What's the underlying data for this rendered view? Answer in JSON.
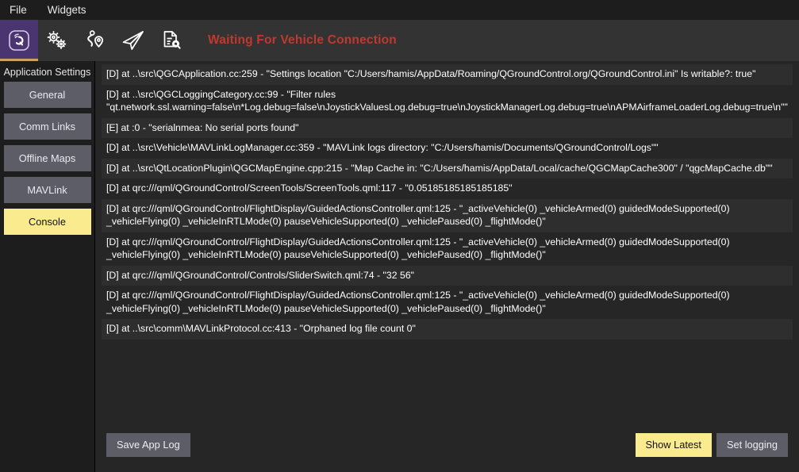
{
  "window": {
    "menu": [
      {
        "label": "File"
      },
      {
        "label": "Widgets"
      }
    ]
  },
  "toolbar": {
    "items": [
      {
        "icon": "qgc-logo-icon",
        "name": "toolbar-button-qgc-menu",
        "active": true
      },
      {
        "icon": "gears-icon",
        "name": "toolbar-button-settings",
        "active": false
      },
      {
        "icon": "waypoints-plan-icon",
        "name": "toolbar-button-plan",
        "active": false
      },
      {
        "icon": "paper-plane-icon",
        "name": "toolbar-button-fly",
        "active": false
      },
      {
        "icon": "document-search-icon",
        "name": "toolbar-button-analyze",
        "active": false
      }
    ],
    "status_text": "Waiting For Vehicle Connection",
    "status_color": "#c0392f",
    "active_highlight_color": "#4a3570",
    "active_underline_color": "#c8a35a"
  },
  "sidebar": {
    "title": "Application Settings",
    "items": [
      {
        "label": "General",
        "selected": false
      },
      {
        "label": "Comm Links",
        "selected": false
      },
      {
        "label": "Offline Maps",
        "selected": false
      },
      {
        "label": "MAVLink",
        "selected": false
      },
      {
        "label": "Console",
        "selected": true
      }
    ],
    "selected_color": "#faeb8e",
    "item_color": "#5d5d68"
  },
  "console": {
    "lines": [
      "[D] at ..\\src\\QGCApplication.cc:259 - \"Settings location \"C:/Users/hamis/AppData/Roaming/QGroundControl.org/QGroundControl.ini\" Is writable?: true\"",
      "[D] at ..\\src\\QGCLoggingCategory.cc:99 - \"Filter rules \"qt.network.ssl.warning=false\\n*Log.debug=false\\nJoystickValuesLog.debug=true\\nJoystickManagerLog.debug=true\\nAPMAirframeLoaderLog.debug=true\\n\"\"",
      "[E] at :0 - \"serialnmea: No serial ports found\"",
      "[D] at ..\\src\\Vehicle\\MAVLinkLogManager.cc:359 - \"MAVLink logs directory: \"C:/Users/hamis/Documents/QGroundControl/Logs\"\"",
      "[D] at ..\\src\\QtLocationPlugin\\QGCMapEngine.cpp:215 - \"Map Cache in: \"C:/Users/hamis/AppData/Local/cache/QGCMapCache300\" / \"qgcMapCache.db\"\"",
      "[D] at qrc:///qml/QGroundControl/ScreenTools/ScreenTools.qml:117 - \"0.05185185185185185\"",
      "[D] at qrc:///qml/QGroundControl/FlightDisplay/GuidedActionsController.qml:125 - \"_activeVehicle(0) _vehicleArmed(0) guidedModeSupported(0) _vehicleFlying(0) _vehicleInRTLMode(0) pauseVehicleSupported(0) _vehiclePaused(0) _flightMode()\"",
      "[D] at qrc:///qml/QGroundControl/FlightDisplay/GuidedActionsController.qml:125 - \"_activeVehicle(0) _vehicleArmed(0) guidedModeSupported(0) _vehicleFlying(0) _vehicleInRTLMode(0) pauseVehicleSupported(0) _vehiclePaused(0) _flightMode()\"",
      "[D] at qrc:///qml/QGroundControl/Controls/SliderSwitch.qml:74 - \"32 56\"",
      "[D] at qrc:///qml/QGroundControl/FlightDisplay/GuidedActionsController.qml:125 - \"_activeVehicle(0) _vehicleArmed(0) guidedModeSupported(0) _vehicleFlying(0) _vehicleInRTLMode(0) pauseVehicleSupported(0) _vehiclePaused(0) _flightMode()\"",
      "[D] at ..\\src\\comm\\MAVLinkProtocol.cc:413 - \"Orphaned log file count 0\""
    ],
    "buttons": {
      "save_app_log": "Save App Log",
      "show_latest": "Show Latest",
      "set_logging": "Set logging"
    }
  }
}
